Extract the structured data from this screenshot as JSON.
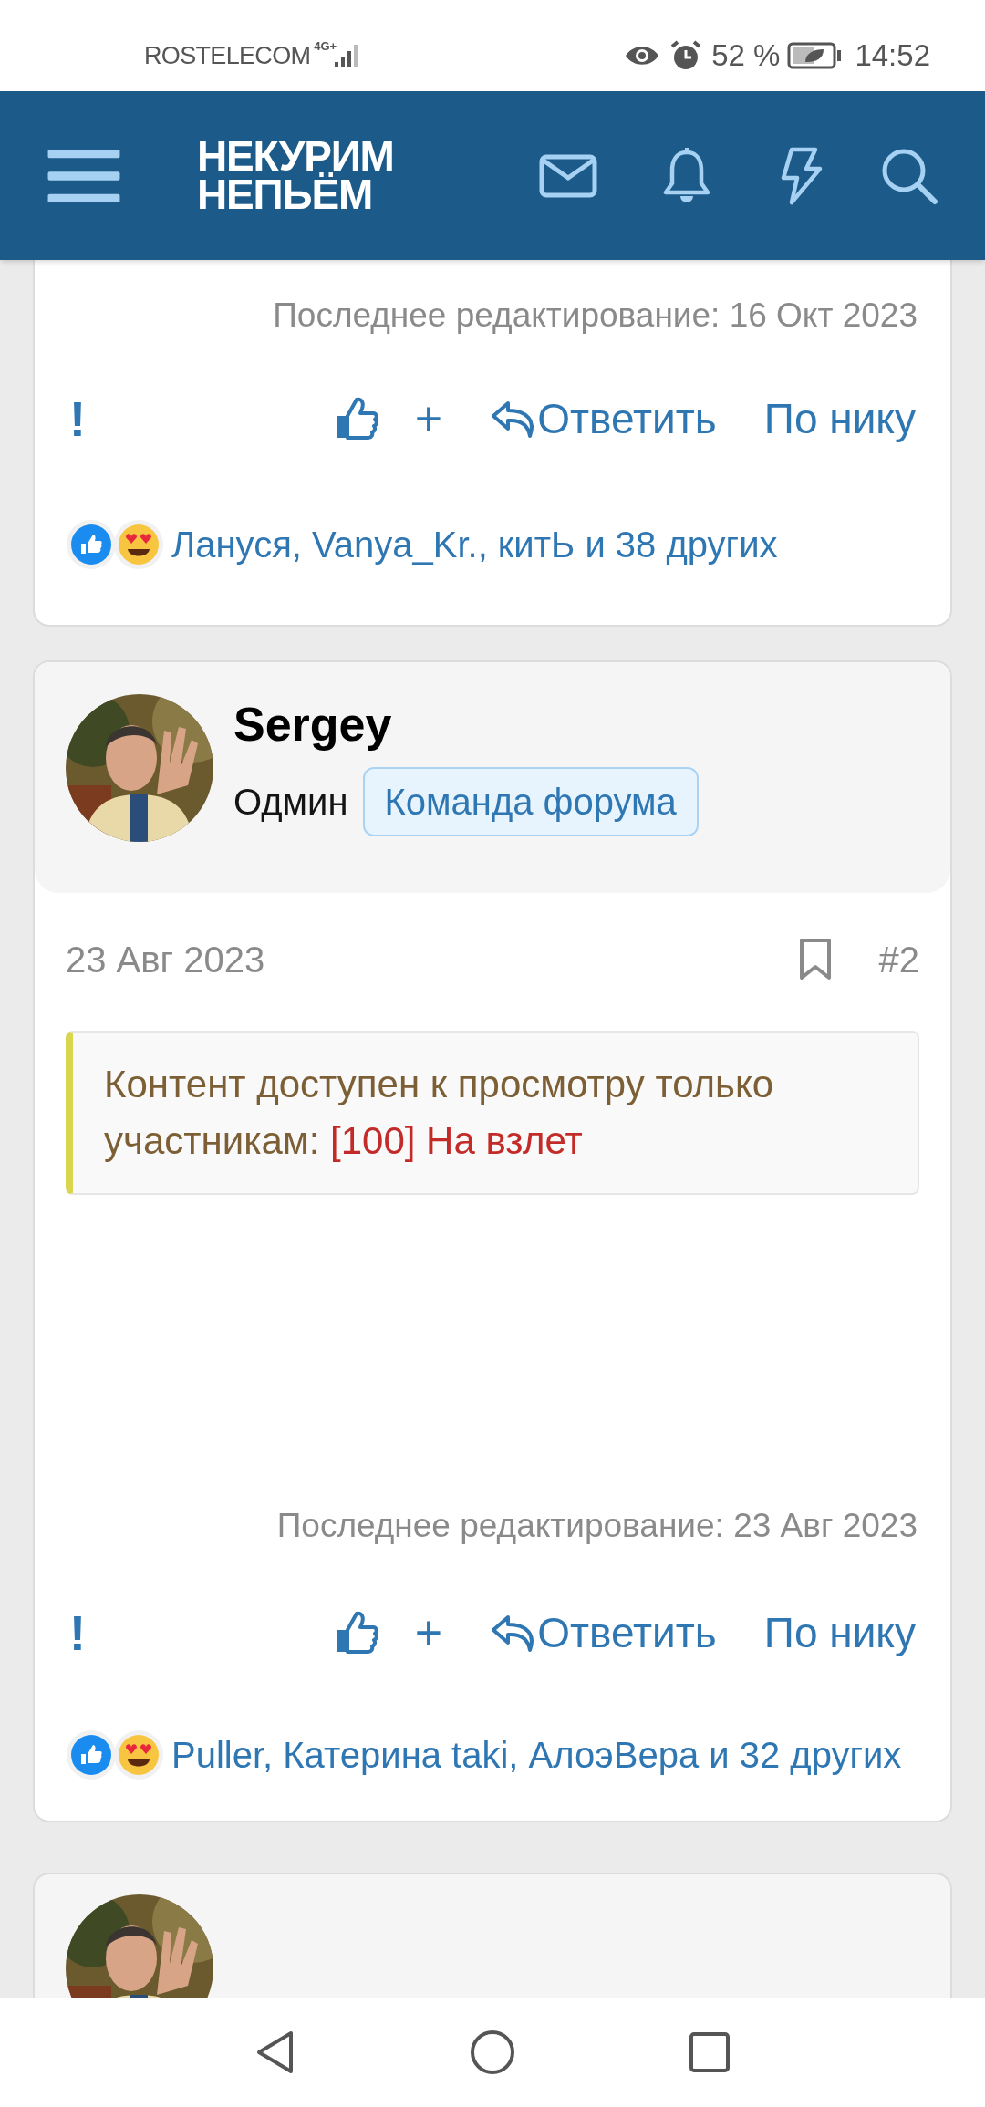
{
  "status_bar": {
    "carrier": "ROSTELECOM",
    "network": "4G+",
    "battery": "52 %",
    "time": "14:52"
  },
  "header": {
    "logo_lines": [
      "НЕКУРИМ",
      "НЕПЬЁМ"
    ]
  },
  "posts": [
    {
      "kind": "bottom",
      "last_edited": "Последнее редактирование: 16 Окт 2023",
      "actions": {
        "report": "!",
        "add": "+",
        "reply": "Ответить",
        "by_nick": "По нику"
      },
      "reactions": "Лануся, Vanya_Kr., китЬ и 38 других"
    },
    {
      "kind": "full",
      "author": "Sergey",
      "role": "Одмин",
      "badge": "Команда форума",
      "date": "23 Авг 2023",
      "number": "#2",
      "bookmarked": false,
      "quote": {
        "text": "Контент доступен к просмотру только участникам: ",
        "link": "[100] На взлет"
      },
      "last_edited": "Последнее редактирование: 23 Авг 2023",
      "actions": {
        "report": "!",
        "add": "+",
        "reply": "Ответить",
        "by_nick": "По нику"
      },
      "reactions": "Puller, Катерина taki, АлоэВера и 32 других"
    },
    {
      "kind": "top"
    }
  ]
}
